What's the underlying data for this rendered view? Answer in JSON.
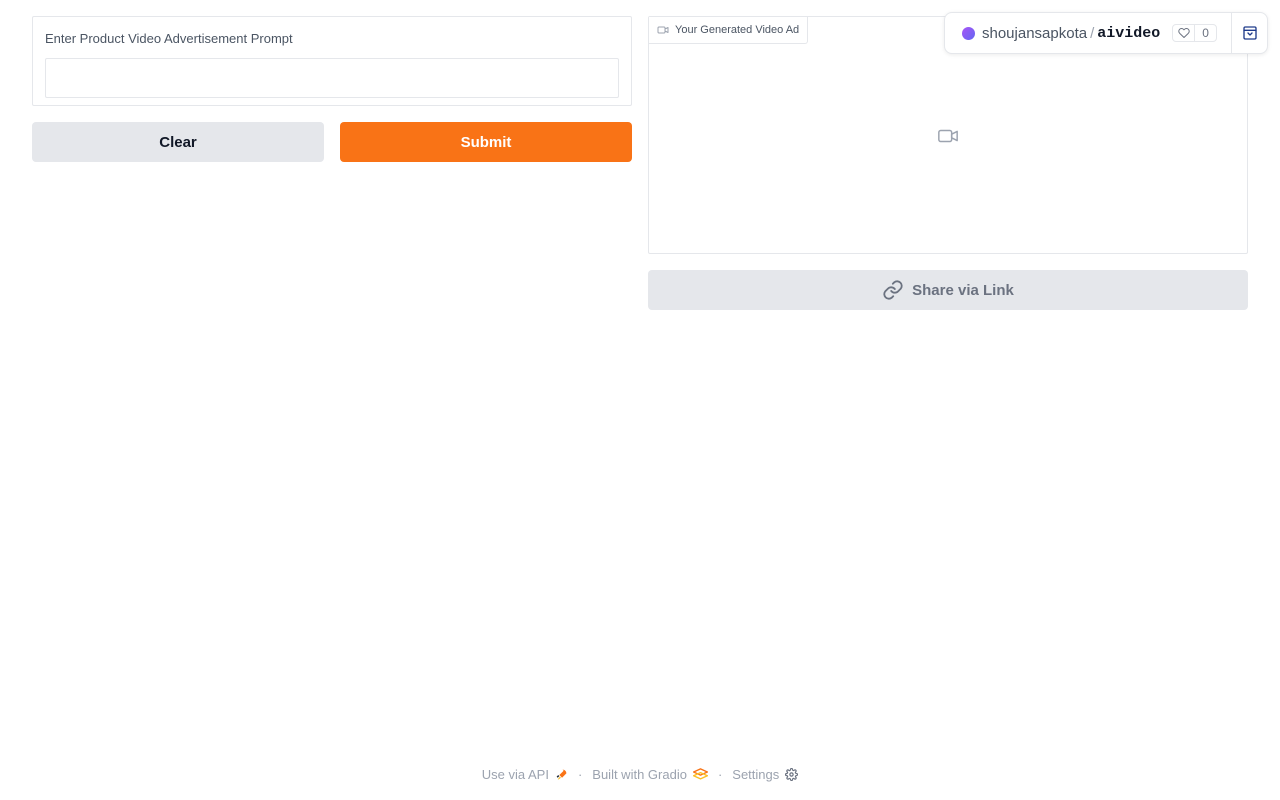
{
  "input": {
    "label": "Enter Product Video Advertisement Prompt",
    "value": "",
    "placeholder": ""
  },
  "buttons": {
    "clear": "Clear",
    "submit": "Submit",
    "share": "Share via Link"
  },
  "video": {
    "label": "Your Generated Video Ad"
  },
  "space_badge": {
    "owner": "shoujansapkota",
    "separator": "/",
    "space": "aivideo",
    "likes": "0"
  },
  "footer": {
    "api": "Use via API",
    "dot1": "·",
    "built": "Built with Gradio",
    "dot2": "·",
    "settings": "Settings"
  },
  "colors": {
    "accent": "#f97316",
    "secondary_button": "#e5e7eb",
    "border": "#e5e7eb",
    "muted_text": "#9ca3af"
  },
  "icons": {
    "video_tag": "video-camera-icon",
    "video_placeholder": "video-camera-icon",
    "share": "link-icon",
    "like": "heart-icon",
    "collapse": "collapse-icon",
    "api": "rocket-icon",
    "gradio": "gradio-logo-icon",
    "settings": "gear-icon"
  }
}
